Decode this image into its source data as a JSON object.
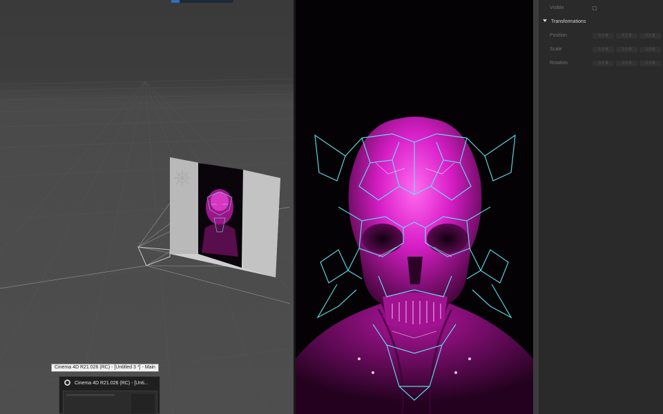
{
  "attributes": {
    "visible_label": "Visible",
    "section_title": "Transformations",
    "rows": [
      {
        "label": "Position",
        "values": [
          "0.0 B",
          "0.0 B",
          "0.0 B"
        ]
      },
      {
        "label": "Scale",
        "values": [
          "1.0 B",
          "1.0 B",
          "1.0 B"
        ]
      },
      {
        "label": "Rotation",
        "values": [
          "0.0 B",
          "0.0 B",
          "0.0 B"
        ]
      }
    ]
  },
  "taskbar": {
    "tooltip": "Cinema 4D R21.026 (RC) - [Untitled 3 *] - Main",
    "thumbnail_title": "Cinema 4D R21.026 (RC) - [Unti..."
  },
  "colors": {
    "skull_magenta": "#d81fc8",
    "wire_cyan": "#5fe0f0",
    "preview_bg": "#040204",
    "viewport_floor": "#4e4e4e"
  }
}
